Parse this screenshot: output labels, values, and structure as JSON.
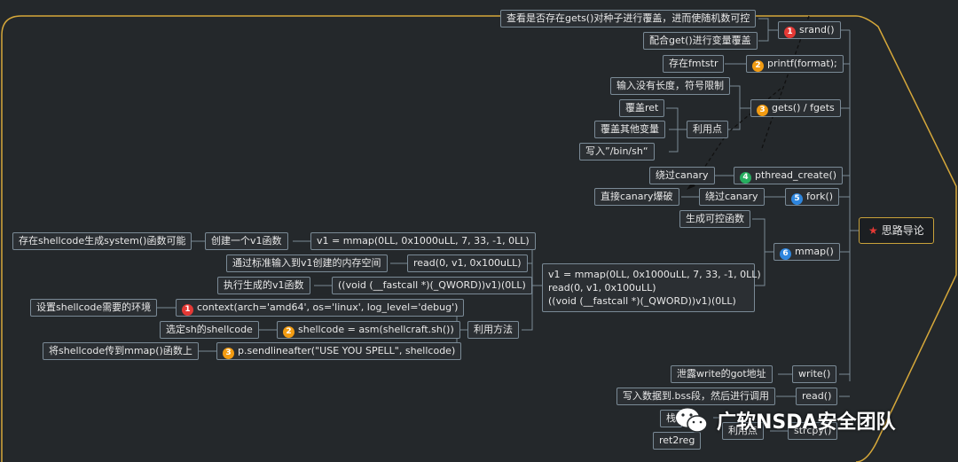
{
  "colors": {
    "background": "#24282b",
    "border": "#7a8a96",
    "root_border": "#c9a23a",
    "frame": "#d6a83a",
    "badge_red": "#e53935",
    "badge_orange": "#f39c12",
    "badge_green": "#27ae60",
    "badge_blue": "#2e86de"
  },
  "root": {
    "label": "思路导论",
    "icon": "star-icon"
  },
  "branches": {
    "srand": {
      "num": "1",
      "label": "srand()",
      "children": [
        "查看是否存在gets()对种子进行覆盖，进而使随机数可控",
        "配合get()进行变量覆盖"
      ]
    },
    "printf": {
      "num": "2",
      "label": "printf(format);",
      "children": [
        "存在fmtstr"
      ]
    },
    "gets": {
      "num": "3",
      "label": "gets() / fgets",
      "children": [
        "输入没有长度，符号限制"
      ],
      "usage": {
        "label": "利用点",
        "children": [
          "覆盖ret",
          "覆盖其他变量",
          "写入”/bin/sh“"
        ]
      }
    },
    "pthread": {
      "num": "4",
      "label": "pthread_create()",
      "children": [
        "绕过canary"
      ]
    },
    "fork": {
      "num": "5",
      "label": "fork()",
      "child": "绕过canary",
      "grandchild": "直接canary爆破"
    },
    "mmap": {
      "num": "6",
      "label": "mmap()",
      "gen": "生成可控函数",
      "code": "v1 = mmap(0LL, 0x1000uLL, 7, 33, -1, 0LL)\nread(0, v1, 0x100uLL)\n((void (__fastcall *)(_QWORD))v1)(0LL)",
      "lines": [
        {
          "code": "v1 = mmap(0LL, 0x1000uLL, 7, 33, -1, 0LL)",
          "desc": "创建一个v1函数",
          "extra": "存在shellcode生成system()函数可能"
        },
        {
          "code": "read(0, v1, 0x100uLL)",
          "desc": "通过标准输入到v1创建的内存空间"
        },
        {
          "code": "((void (__fastcall *)(_QWORD))v1)(0LL)",
          "desc": "执行生成的v1函数"
        }
      ],
      "method": {
        "label": "利用方法",
        "steps": [
          {
            "num": "1",
            "code": "context(arch='amd64', os='linux', log_level='debug')",
            "desc": "设置shellcode需要的环境"
          },
          {
            "num": "2",
            "code": "shellcode = asm(shellcraft.sh())",
            "desc": "选定sh的shellcode"
          },
          {
            "num": "3",
            "code": "p.sendlineafter(\"USE YOU SPELL\", shellcode)",
            "desc": "将shellcode传到mmap()函数上"
          }
        ]
      }
    },
    "write": {
      "label": "write()",
      "child": "泄露write的got地址"
    },
    "read": {
      "label": "read()",
      "child": "写入数据到.bss段，然后进行调用"
    },
    "strcpy": {
      "label": "strcpy()",
      "usage": "利用点",
      "child": "栈",
      "extra": "ret2reg"
    }
  },
  "watermark": {
    "text": "广软NSDA安全团队",
    "icon": "wechat-icon"
  }
}
